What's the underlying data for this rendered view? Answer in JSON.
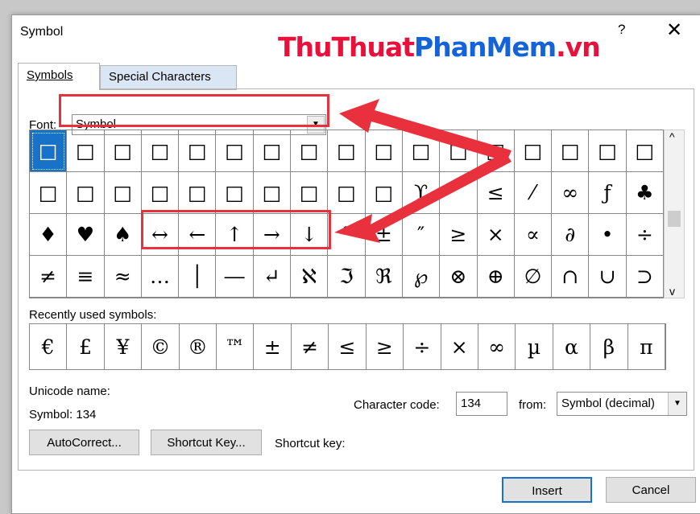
{
  "window": {
    "title": "Symbol",
    "help_label": "?",
    "close_label": "✕"
  },
  "watermark": {
    "part1": "ThuThuat",
    "part2": "PhanMem",
    "part3": ".vn"
  },
  "tabs": [
    {
      "label": "Symbols",
      "active": true
    },
    {
      "label": "Special Characters",
      "active": false
    }
  ],
  "font": {
    "label": "Font:",
    "value": "Symbol"
  },
  "grid": [
    "□",
    "□",
    "□",
    "□",
    "□",
    "□",
    "□",
    "□",
    "□",
    "□",
    "□",
    "□",
    "□",
    "□",
    "□",
    "□",
    "□",
    "□",
    "□",
    "□",
    "□",
    "□",
    "□",
    "□",
    "□",
    "□",
    "□",
    "ϒ",
    "′",
    "≤",
    "⁄",
    "∞",
    "ƒ",
    "♣",
    "♦",
    "♥",
    "♠",
    "↔",
    "←",
    "↑",
    "→",
    "↓",
    "°",
    "±",
    "″",
    "≥",
    "×",
    "∝",
    "∂",
    "•",
    "÷",
    "≠",
    "≡",
    "≈",
    "…",
    "│",
    "―",
    "↵",
    "ℵ",
    "ℑ",
    "ℜ",
    "℘",
    "⊗",
    "⊕",
    "∅",
    "∩",
    "∪",
    "⊃"
  ],
  "grid_selected_index": 0,
  "recent": {
    "label": "Recently used symbols:",
    "symbols": [
      "€",
      "£",
      "¥",
      "©",
      "®",
      "™",
      "±",
      "≠",
      "≤",
      "≥",
      "÷",
      "×",
      "∞",
      "µ",
      "α",
      "β",
      "π"
    ]
  },
  "unicode": {
    "label": "Unicode name:",
    "value": "Symbol: 134"
  },
  "char_code": {
    "label": "Character code:",
    "value": "134"
  },
  "from": {
    "label": "from:",
    "value": "Symbol (decimal)"
  },
  "buttons": {
    "autocorrect": "AutoCorrect...",
    "shortcut_key": "Shortcut Key...",
    "insert": "Insert",
    "cancel": "Cancel"
  },
  "shortcut_key_label": "Shortcut key:",
  "annotation_color": "#e8313c",
  "selection_color": "#1873c8"
}
